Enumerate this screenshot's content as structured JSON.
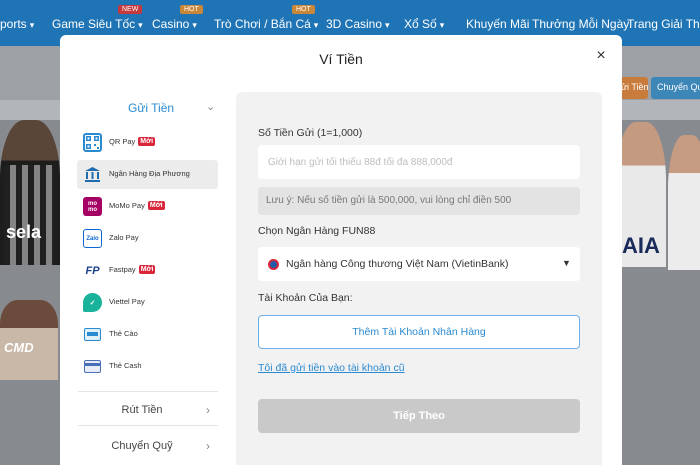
{
  "nav": {
    "items": [
      {
        "label": "Sports",
        "badge": ""
      },
      {
        "label": "Game Siêu Tốc",
        "badge": "NEW"
      },
      {
        "label": "Casino",
        "badge": "HOT"
      },
      {
        "label": "Trò Chơi / Bắn Cá",
        "badge": "HOT"
      },
      {
        "label": "3D Casino",
        "badge": ""
      },
      {
        "label": "Xổ Số",
        "badge": ""
      },
      {
        "label": "Khuyến Mãi",
        "badge": ""
      },
      {
        "label": "Thưởng Mỗi Ngày",
        "badge": ""
      },
      {
        "label": "Trang Giải Thưởng",
        "badge": ""
      }
    ]
  },
  "background": {
    "side_buttons": [
      "Gửi Tiền",
      "Chuyển Quỹ"
    ],
    "left_banner_text": "sela",
    "right_banner_text": "AIA",
    "girl_banner_text": "CMD"
  },
  "modal": {
    "title": "Ví Tiền",
    "close_symbol": "×"
  },
  "menu": {
    "deposit_label": "Gửi Tiền",
    "payment_methods": [
      {
        "label": "QR Pay",
        "badge": "Mới",
        "icon": "qr-code-icon"
      },
      {
        "label": "Ngân Hàng Địa Phương",
        "badge": "",
        "icon": "bank-icon",
        "active": true
      },
      {
        "label": "MoMo Pay",
        "badge": "Mới",
        "icon": "momo-icon",
        "icon_text": "mo mo"
      },
      {
        "label": "Zalo Pay",
        "badge": "",
        "icon": "zalopay-icon",
        "icon_text": "Zalo"
      },
      {
        "label": "Fastpay",
        "badge": "Mới",
        "icon": "fastpay-icon",
        "icon_text": "FP"
      },
      {
        "label": "Viettel Pay",
        "badge": "",
        "icon": "viettel-pay-icon"
      },
      {
        "label": "Thẻ Cào",
        "badge": "",
        "icon": "scratch-card-icon"
      },
      {
        "label": "Thẻ Cash",
        "badge": "",
        "icon": "cash-card-icon"
      }
    ],
    "withdraw_label": "Rút Tiền",
    "transfer_label": "Chuyển Quỹ"
  },
  "form": {
    "amount_label": "Số Tiền Gửi (1=1,000)",
    "amount_placeholder": "Giới hạn gửi tối thiểu 88đ tối đa 888,000đ",
    "note": "Lưu ý: Nếu số tiền gửi là 500,000, vui lòng chỉ điền 500",
    "bank_label": "Chọn Ngân Hàng FUN88",
    "selected_bank": "Ngân hàng Công thương Việt Nam (VietinBank)",
    "account_label": "Tài Khoản Của Bạn:",
    "add_account_button": "Thêm Tài Khoản Nhân Hàng",
    "old_account_link": "Tôi đã gửi tiền vào tài khoản cũ",
    "next_button": "Tiếp Theo"
  },
  "colors": {
    "nav_bg": "#1f74b5",
    "accent_blue": "#2a8ad1",
    "badge_red": "#d9263a",
    "disabled_gray": "#c9c9c9"
  }
}
